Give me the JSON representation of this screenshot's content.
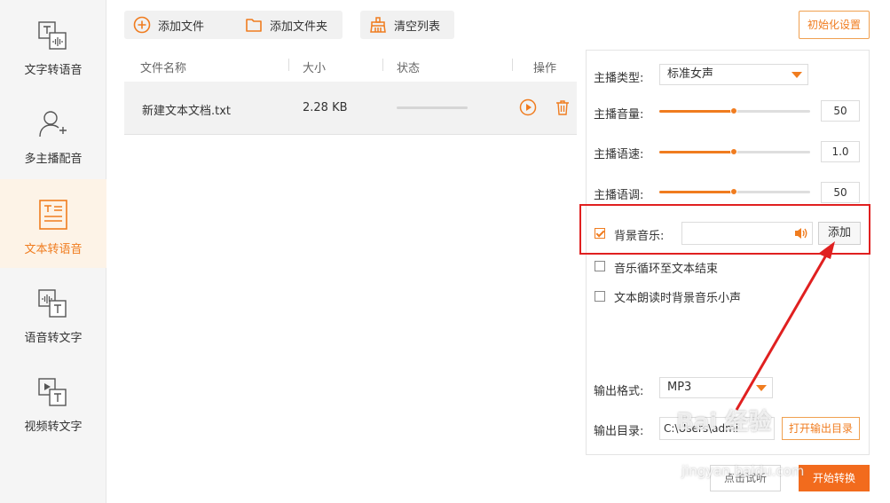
{
  "sidebar": {
    "items": [
      {
        "label": "文字转语音",
        "icon": "text-to-speech-icon",
        "active": false
      },
      {
        "label": "多主播配音",
        "icon": "multi-anchor-icon",
        "active": false
      },
      {
        "label": "文本转语音",
        "icon": "document-to-speech-icon",
        "active": true
      },
      {
        "label": "语音转文字",
        "icon": "speech-to-text-icon",
        "active": false
      },
      {
        "label": "视频转文字",
        "icon": "video-to-text-icon",
        "active": false
      }
    ]
  },
  "toolbar": {
    "add_file": "添加文件",
    "add_folder": "添加文件夹",
    "clear_list": "清空列表",
    "init_settings": "初始化设置"
  },
  "table": {
    "headers": [
      "文件名称",
      "大小",
      "状态",
      "操作"
    ],
    "rows": [
      {
        "name": "新建文本文档.txt",
        "size": "2.28 KB",
        "progress": 0
      }
    ]
  },
  "settings": {
    "anchor_type_label": "主播类型:",
    "anchor_type_value": "标准女声",
    "volume_label": "主播音量:",
    "volume_value": "50",
    "speed_label": "主播语速:",
    "speed_value": "1.0",
    "pitch_label": "主播语调:",
    "pitch_value": "50",
    "bg_music_label": "背景音乐:",
    "bg_music_checked": true,
    "bg_music_value": "",
    "add_label": "添加",
    "loop_label": "音乐循环至文本结束",
    "loop_checked": false,
    "quiet_label": "文本朗读时背景音乐小声",
    "quiet_checked": false,
    "output_format_label": "输出格式:",
    "output_format_value": "MP3",
    "output_dir_label": "输出目录:",
    "output_dir_value": "C:\\Users\\admi",
    "open_dir_label": "打开输出目录"
  },
  "footer": {
    "preview_label": "点击试听",
    "convert_label": "开始转换"
  },
  "watermark": {
    "line1": "Bai 经验",
    "line2": "jingyan.baidu.com"
  },
  "colors": {
    "accent": "#f07c1f",
    "convert_button": "#f26b1d",
    "highlight": "#e02020"
  }
}
